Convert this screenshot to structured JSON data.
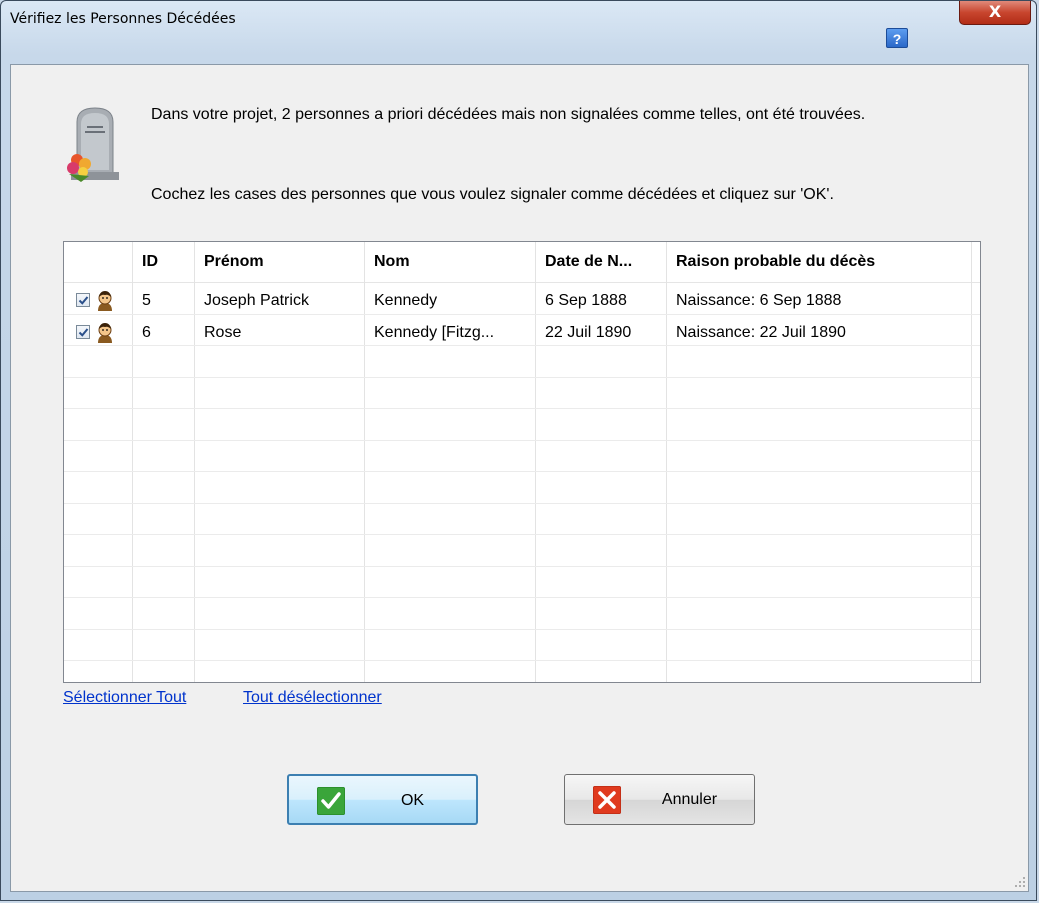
{
  "window": {
    "title": "Vérifiez les Personnes Décédées",
    "help_label": "?",
    "close_label": "X"
  },
  "message": {
    "line1": "Dans votre projet, 2 personnes a priori décédées mais non signalées comme telles, ont été trouvées.",
    "line2": "Cochez les cases des personnes que vous voulez signaler comme décédées et cliquez sur 'OK'."
  },
  "table": {
    "columns": [
      "",
      "ID",
      "Prénom",
      "Nom",
      "Date de N...",
      "Raison probable du décès"
    ],
    "rows": [
      {
        "checked": true,
        "id": "5",
        "prenom": "Joseph Patrick",
        "nom": "Kennedy",
        "date": "6 Sep 1888",
        "raison": "Naissance: 6 Sep 1888"
      },
      {
        "checked": true,
        "id": "6",
        "prenom": "Rose",
        "nom": "Kennedy [Fitzg...",
        "date": "22 Juil 1890",
        "raison": "Naissance: 22 Juil 1890"
      }
    ]
  },
  "links": {
    "select_all": "Sélectionner Tout",
    "deselect_all": "Tout désélectionner"
  },
  "buttons": {
    "ok": "OK",
    "cancel": "Annuler"
  },
  "colors": {
    "ok_icon": "#3aa53a",
    "cancel_icon": "#e03a1e",
    "link": "#0033cc"
  }
}
